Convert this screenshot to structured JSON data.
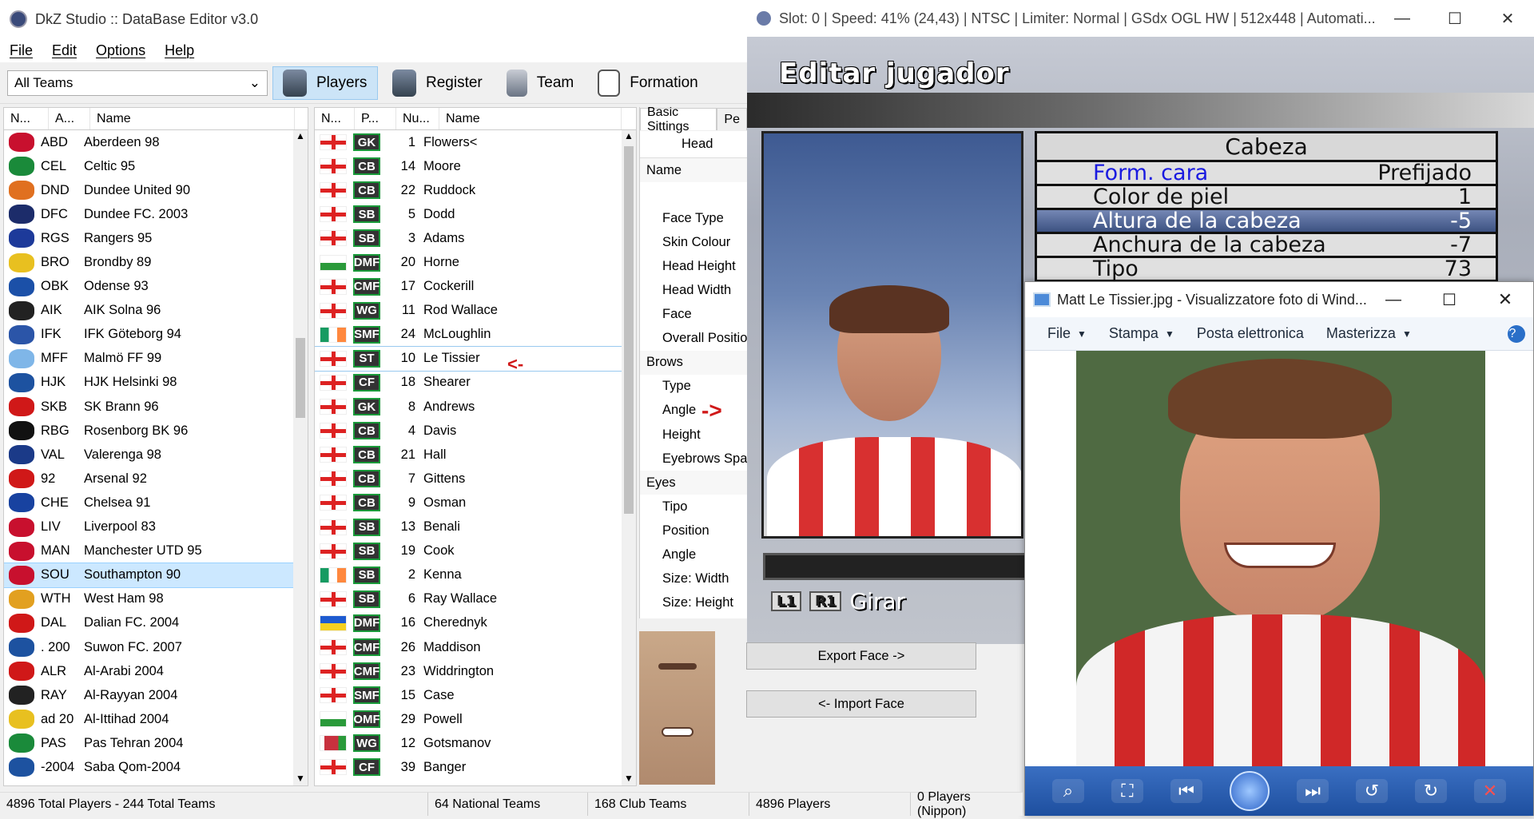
{
  "dkz": {
    "title": "DkZ Studio :: DataBase Editor v3.0",
    "menu": [
      "File",
      "Edit",
      "Options",
      "Help"
    ],
    "team_filter": "All Teams",
    "toolbar": [
      "Players",
      "Register",
      "Team",
      "Formation"
    ],
    "teams_headers": [
      "N...",
      "A...",
      "Name"
    ],
    "teams": [
      {
        "abbr": "ABD",
        "name": "Aberdeen 98",
        "color": "#c8102e"
      },
      {
        "abbr": "CEL",
        "name": "Celtic 95",
        "color": "#1a8a3a"
      },
      {
        "abbr": "DND",
        "name": "Dundee United 90",
        "color": "#e07020"
      },
      {
        "abbr": "DFC",
        "name": "Dundee FC. 2003",
        "color": "#1c2c6a"
      },
      {
        "abbr": "RGS",
        "name": "Rangers 95",
        "color": "#1d3a9a"
      },
      {
        "abbr": "BRO",
        "name": "Brondby 89",
        "color": "#e8c020"
      },
      {
        "abbr": "OBK",
        "name": "Odense 93",
        "color": "#1b50a8"
      },
      {
        "abbr": "AIK",
        "name": "AIK Solna 96",
        "color": "#222222"
      },
      {
        "abbr": "IFK",
        "name": "IFK Göteborg 94",
        "color": "#2b55a8"
      },
      {
        "abbr": "MFF",
        "name": "Malmö FF 99",
        "color": "#7fb6e8"
      },
      {
        "abbr": "HJK",
        "name": "HJK Helsinki 98",
        "color": "#1d52a0"
      },
      {
        "abbr": "SKB",
        "name": "SK Brann 96",
        "color": "#d01818"
      },
      {
        "abbr": "RBG",
        "name": "Rosenborg BK 96",
        "color": "#111111"
      },
      {
        "abbr": "VAL",
        "name": "Valerenga 98",
        "color": "#1b3a88"
      },
      {
        "abbr": "92",
        "name": "Arsenal 92",
        "color": "#d01818"
      },
      {
        "abbr": "CHE",
        "name": "Chelsea 91",
        "color": "#1842a0"
      },
      {
        "abbr": "LIV",
        "name": "Liverpool 83",
        "color": "#c8102e"
      },
      {
        "abbr": "MAN",
        "name": "Manchester UTD 95",
        "color": "#c8102e"
      },
      {
        "abbr": "SOU",
        "name": "Southampton 90",
        "color": "#c8102e"
      },
      {
        "abbr": "WTH",
        "name": "West Ham 98",
        "color": "#e2a020"
      },
      {
        "abbr": "DAL",
        "name": "Dalian FC. 2004",
        "color": "#d01818"
      },
      {
        "abbr": ". 200",
        "name": "Suwon FC. 2007",
        "color": "#1d52a0"
      },
      {
        "abbr": "ALR",
        "name": "Al-Arabi 2004",
        "color": "#d01818"
      },
      {
        "abbr": "RAY",
        "name": "Al-Rayyan 2004",
        "color": "#222222"
      },
      {
        "abbr": "ad 20",
        "name": "Al-Ittihad 2004",
        "color": "#e8c020"
      },
      {
        "abbr": "PAS",
        "name": "Pas Tehran 2004",
        "color": "#1a8a3a"
      },
      {
        "abbr": "-2004",
        "name": "Saba Qom-2004",
        "color": "#1d52a0"
      }
    ],
    "selected_team": "SOU",
    "players_headers": [
      "N...",
      "P...",
      "Nu...",
      "Name"
    ],
    "players": [
      {
        "flag": "eng",
        "pos": "GK",
        "num": "1",
        "name": "Flowers<"
      },
      {
        "flag": "eng",
        "pos": "CB",
        "num": "14",
        "name": "Moore"
      },
      {
        "flag": "eng",
        "pos": "CB",
        "num": "22",
        "name": "Ruddock"
      },
      {
        "flag": "eng",
        "pos": "SB",
        "num": "5",
        "name": "Dodd"
      },
      {
        "flag": "eng",
        "pos": "SB",
        "num": "3",
        "name": "Adams"
      },
      {
        "flag": "wal",
        "pos": "DMF",
        "num": "20",
        "name": "Horne"
      },
      {
        "flag": "eng",
        "pos": "CMF",
        "num": "17",
        "name": "Cockerill"
      },
      {
        "flag": "eng",
        "pos": "WG",
        "num": "11",
        "name": "Rod Wallace"
      },
      {
        "flag": "irl",
        "pos": "SMF",
        "num": "24",
        "name": "McLoughlin"
      },
      {
        "flag": "eng",
        "pos": "ST",
        "num": "10",
        "name": "Le Tissier"
      },
      {
        "flag": "eng",
        "pos": "CF",
        "num": "18",
        "name": "Shearer"
      },
      {
        "flag": "eng",
        "pos": "GK",
        "num": "8",
        "name": "Andrews"
      },
      {
        "flag": "eng",
        "pos": "CB",
        "num": "4",
        "name": "Davis"
      },
      {
        "flag": "eng",
        "pos": "CB",
        "num": "21",
        "name": "Hall"
      },
      {
        "flag": "eng",
        "pos": "CB",
        "num": "7",
        "name": "Gittens"
      },
      {
        "flag": "eng",
        "pos": "CB",
        "num": "9",
        "name": "Osman"
      },
      {
        "flag": "eng",
        "pos": "SB",
        "num": "13",
        "name": "Benali"
      },
      {
        "flag": "eng",
        "pos": "SB",
        "num": "19",
        "name": "Cook"
      },
      {
        "flag": "irl",
        "pos": "SB",
        "num": "2",
        "name": "Kenna"
      },
      {
        "flag": "eng",
        "pos": "SB",
        "num": "6",
        "name": "Ray Wallace"
      },
      {
        "flag": "ukr",
        "pos": "DMF",
        "num": "16",
        "name": "Cherednyk"
      },
      {
        "flag": "eng",
        "pos": "CMF",
        "num": "26",
        "name": "Maddison"
      },
      {
        "flag": "eng",
        "pos": "CMF",
        "num": "23",
        "name": "Widdrington"
      },
      {
        "flag": "eng",
        "pos": "SMF",
        "num": "15",
        "name": "Case"
      },
      {
        "flag": "wal",
        "pos": "OMF",
        "num": "29",
        "name": "Powell"
      },
      {
        "flag": "blr",
        "pos": "WG",
        "num": "12",
        "name": "Gotsmanov"
      },
      {
        "flag": "eng",
        "pos": "CF",
        "num": "39",
        "name": "Banger"
      }
    ],
    "selected_player": "Le Tissier",
    "selected_arrow": "<-",
    "settings_tabs": [
      "Basic Sittings",
      "Pe"
    ],
    "settings_subtab": "Head",
    "settings_rows": [
      {
        "label": "Name",
        "cat": true
      },
      {
        "label": "",
        "cat": false
      },
      {
        "label": "Face Type",
        "cat": false
      },
      {
        "label": "Skin Colour",
        "cat": false
      },
      {
        "label": "Head Height",
        "cat": false
      },
      {
        "label": "Head Width",
        "cat": false
      },
      {
        "label": "Face",
        "cat": false
      },
      {
        "label": "Overall Position",
        "cat": false
      },
      {
        "label": "Brows",
        "cat": true
      },
      {
        "label": "Type",
        "cat": false
      },
      {
        "label": "Angle",
        "cat": false
      },
      {
        "label": "Height",
        "cat": false
      },
      {
        "label": "Eyebrows Spacing",
        "cat": false
      },
      {
        "label": "Eyes",
        "cat": true
      },
      {
        "label": "Tipo",
        "cat": false
      },
      {
        "label": "Position",
        "cat": false
      },
      {
        "label": "Angle",
        "cat": false
      },
      {
        "label": "Size: Width",
        "cat": false
      },
      {
        "label": "Size: Height",
        "cat": false
      }
    ],
    "angle_arrow": "->",
    "status": [
      "4896 Total Players  -  244 Total Teams",
      "64 National Teams",
      "168 Club Teams",
      "4896 Players",
      "0 Players (Nippon)"
    ]
  },
  "emu": {
    "title": "Slot: 0 | Speed:  41% (24,43) | NTSC | Limiter: Normal | GSdx OGL HW | 512x448 | Automati...",
    "game_title": "Editar jugador",
    "menu_head": "Cabeza",
    "menu_items": [
      {
        "label": "Form. cara",
        "value": "Prefijado"
      },
      {
        "label": "Color de piel",
        "value": "1"
      },
      {
        "label": "Altura de la cabeza",
        "value": "-5"
      },
      {
        "label": "Anchura de la cabeza",
        "value": "-7"
      },
      {
        "label": "Tipo",
        "value": "73"
      }
    ],
    "girar_keys": [
      "L1",
      "R1"
    ],
    "girar_label": "Girar",
    "export_button": "Export Face ->",
    "import_button": "<- Import Face"
  },
  "viewer": {
    "title": "Matt Le Tissier.jpg - Visualizzatore foto di Wind...",
    "menu": [
      "File",
      "Stampa",
      "Posta elettronica",
      "Masterizza"
    ]
  },
  "colors": {
    "england_red": "#d22222",
    "selection_blue": "#cce8ff",
    "viewer_bar": "#1e4f9f"
  }
}
